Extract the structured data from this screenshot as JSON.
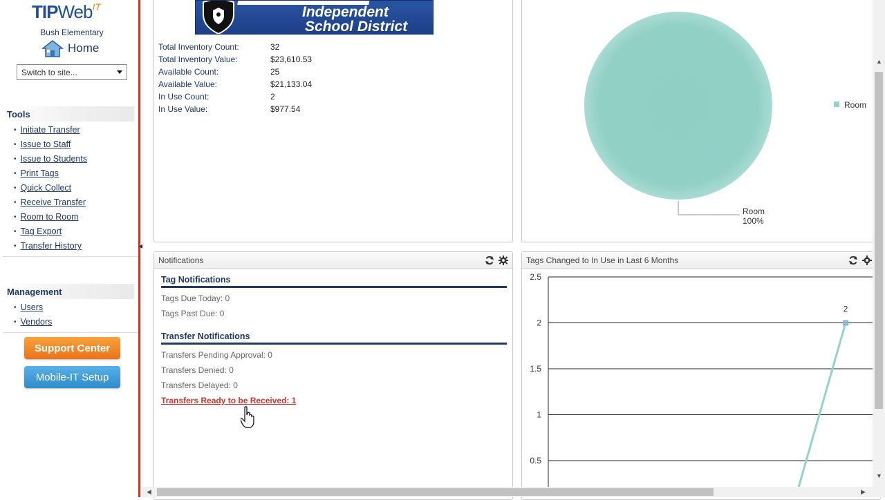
{
  "logo": {
    "tip": "TIP",
    "web": "Web",
    "it": "IT"
  },
  "site": {
    "name": "Bush Elementary",
    "home_label": "Home",
    "switch_placeholder": "Switch to site..."
  },
  "tools": {
    "heading": "Tools",
    "items": [
      "Initiate Transfer",
      "Issue to Staff",
      "Issue to Students",
      "Print Tags",
      "Quick Collect",
      "Receive Transfer",
      "Room to Room",
      "Tag Export",
      "Transfer History"
    ]
  },
  "management": {
    "heading": "Management",
    "items": [
      "Users",
      "Vendors"
    ]
  },
  "buttons": {
    "support": "Support Center",
    "mobile": "Mobile-IT Setup"
  },
  "district": {
    "line1": "Independent",
    "line2": "School District"
  },
  "inventory": [
    {
      "label": "Total Inventory Count:",
      "value": "32"
    },
    {
      "label": "Total Inventory Value:",
      "value": "$23,610.53"
    },
    {
      "label": "Available Count:",
      "value": "25"
    },
    {
      "label": "Available Value:",
      "value": "$21,133.04"
    },
    {
      "label": "In Use Count:",
      "value": "2"
    },
    {
      "label": "In Use Value:",
      "value": "$977.54"
    }
  ],
  "pie": {
    "legend": "Room",
    "callout_label": "Room",
    "callout_pct": "100%",
    "color": "#95d2c8"
  },
  "notifications": {
    "title": "Notifications",
    "tag_heading": "Tag Notifications",
    "tags_due_today": "Tags Due Today: 0",
    "tags_past_due": "Tags Past Due: 0",
    "transfer_heading": "Transfer Notifications",
    "pending_approval": "Transfers Pending Approval: 0",
    "denied": "Transfers Denied: 0",
    "delayed": "Transfers Delayed: 0",
    "ready": "Transfers Ready to be Received: 1"
  },
  "line_chart": {
    "title": "Tags Changed to In Use in Last 6 Months"
  },
  "chart_data": {
    "type": "line",
    "title": "Tags Changed to In Use in Last 6 Months",
    "yticks": [
      "2.5",
      "2",
      "1.5",
      "1",
      "0.5"
    ],
    "ylim": [
      0,
      2.5
    ],
    "point_label": "2",
    "series": [
      {
        "values": [
          0,
          2
        ]
      }
    ],
    "color": "#95d2c8"
  }
}
